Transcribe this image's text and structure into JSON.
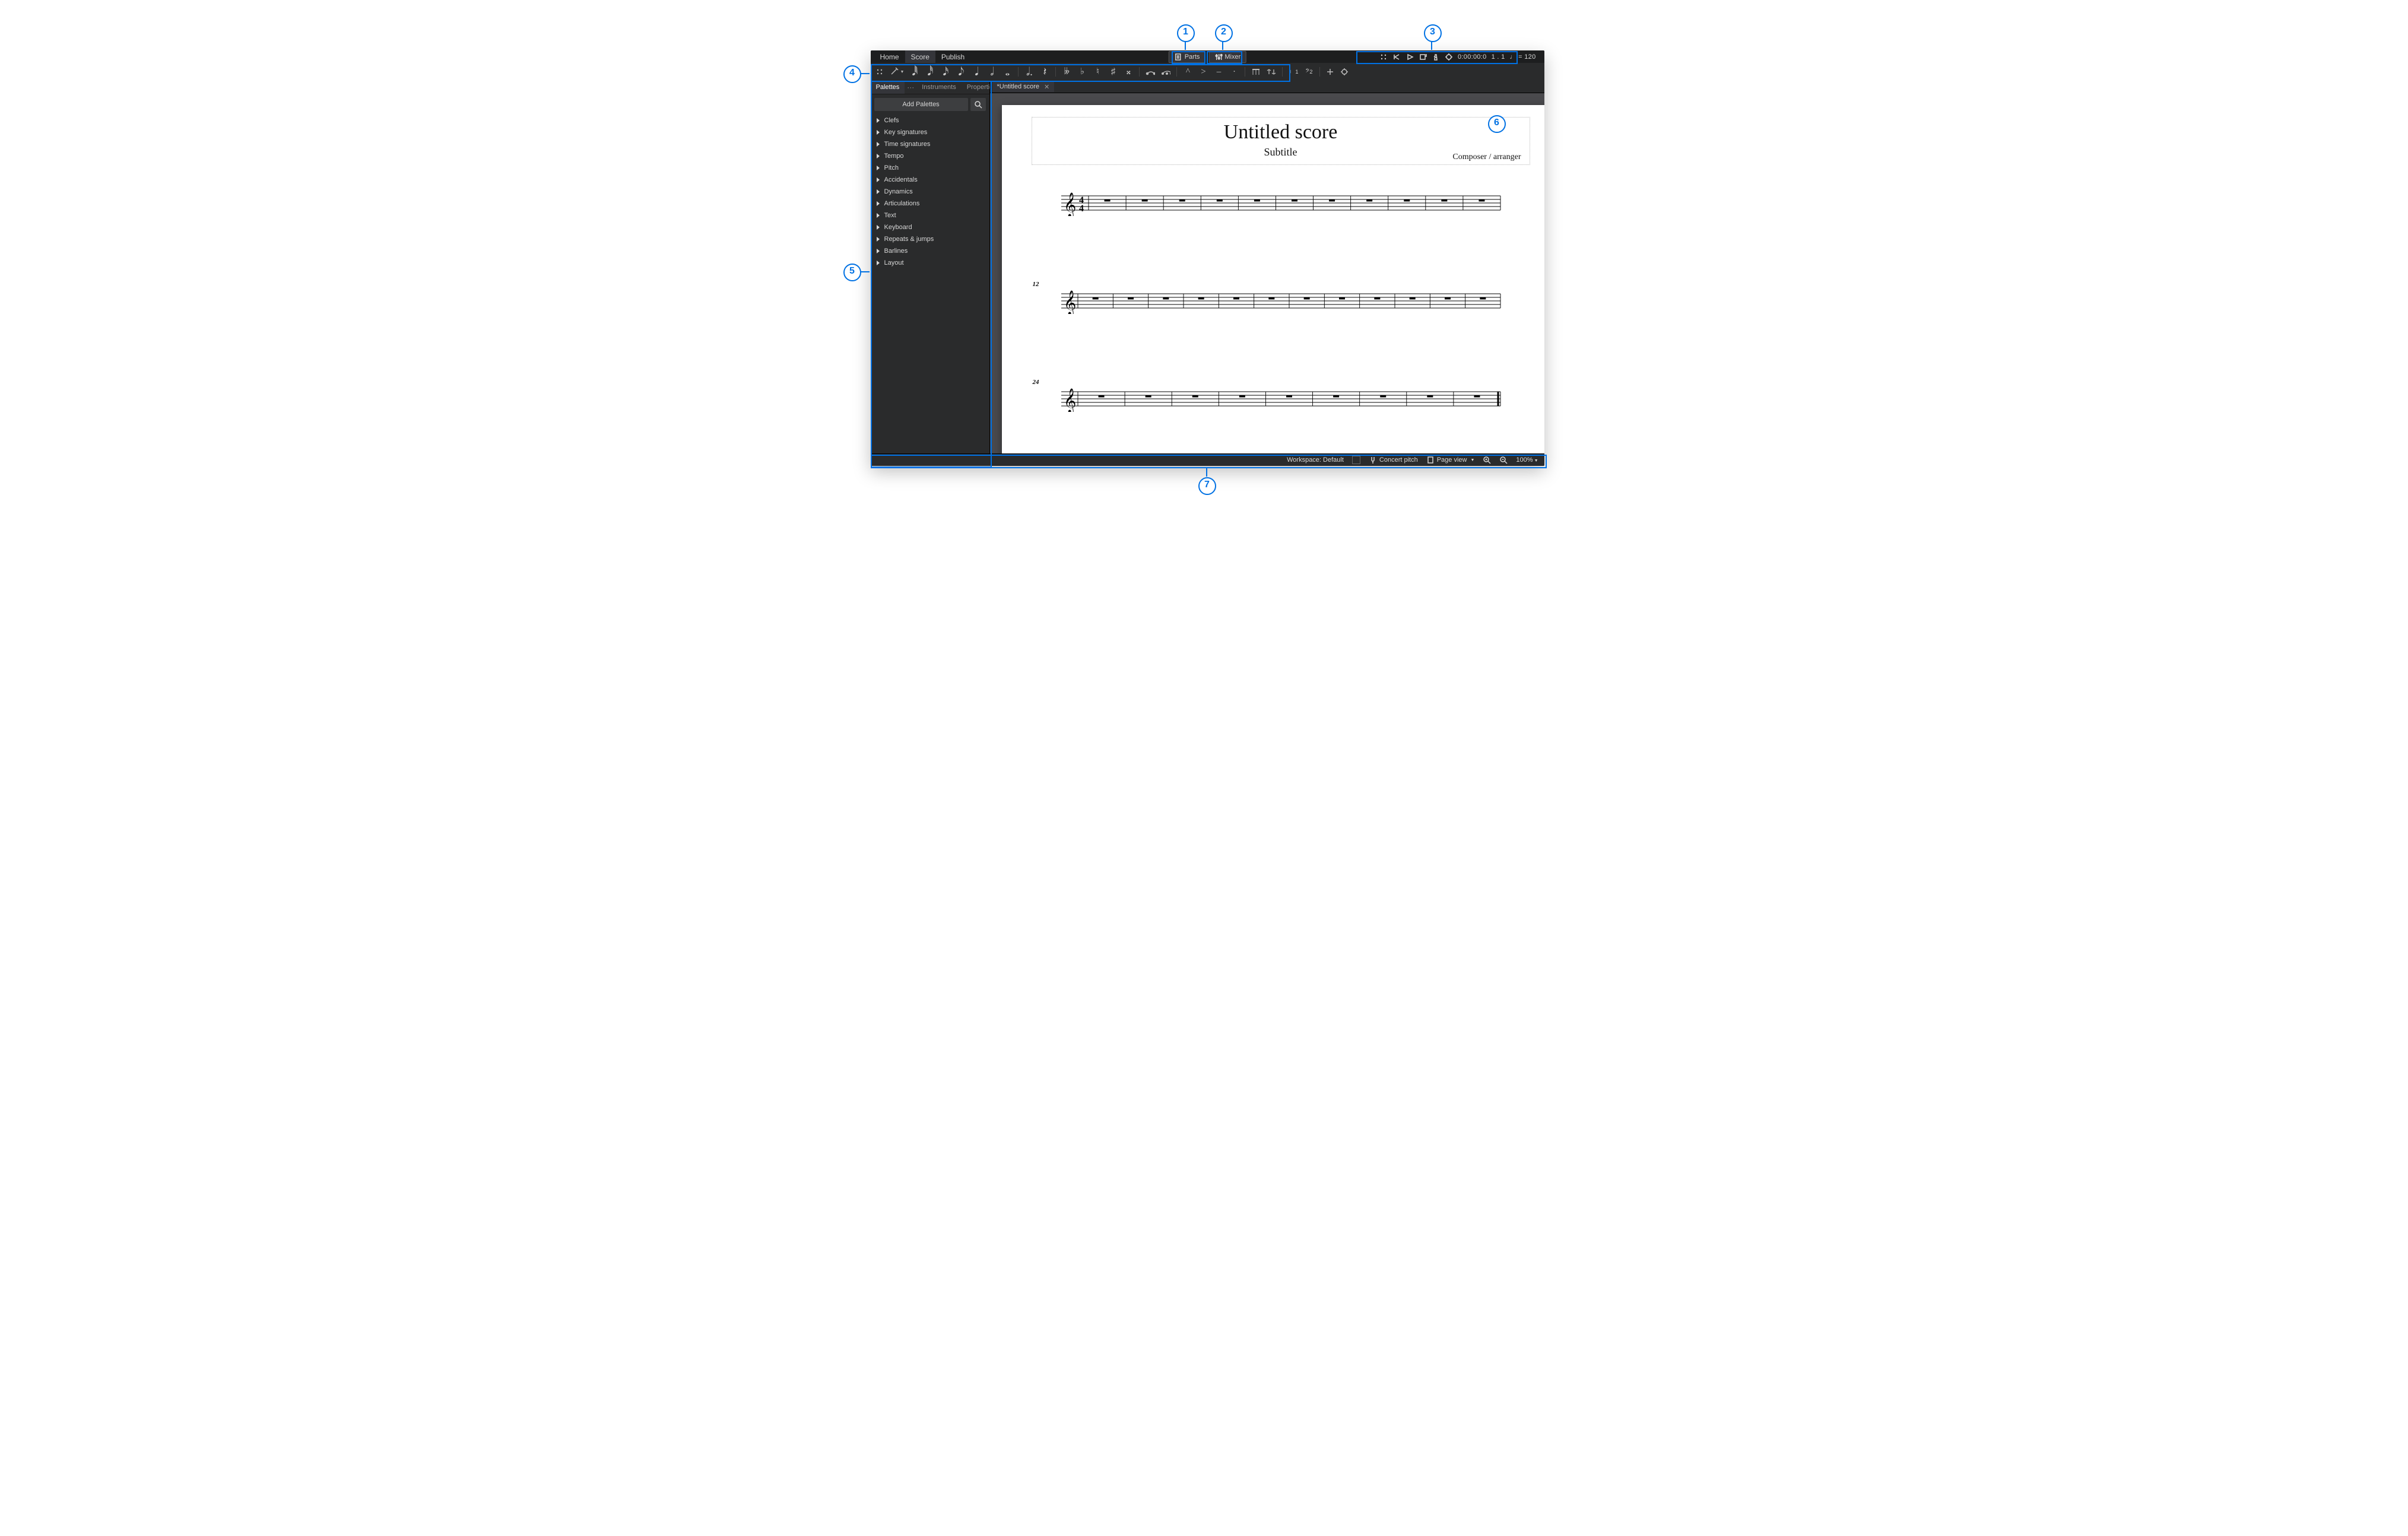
{
  "menubar": {
    "tabs": [
      "Home",
      "Score",
      "Publish"
    ],
    "activeIndex": 1,
    "parts_label": "Parts",
    "mixer_label": "Mixer",
    "time": "0:00:00:0",
    "beat": "1 . 1",
    "tempo_prefix": "♩ = ",
    "tempo_value": "120"
  },
  "sidebar": {
    "tabs": [
      "Palettes",
      "Instruments",
      "Properties"
    ],
    "activeIndex": 0,
    "add_label": "Add Palettes",
    "items": [
      {
        "label": "Clefs"
      },
      {
        "label": "Key signatures"
      },
      {
        "label": "Time signatures"
      },
      {
        "label": "Tempo"
      },
      {
        "label": "Pitch"
      },
      {
        "label": "Accidentals"
      },
      {
        "label": "Dynamics"
      },
      {
        "label": "Articulations"
      },
      {
        "label": "Text"
      },
      {
        "label": "Keyboard"
      },
      {
        "label": "Repeats & jumps"
      },
      {
        "label": "Barlines"
      },
      {
        "label": "Layout"
      }
    ]
  },
  "doc": {
    "tab_label": "*Untitled score",
    "title": "Untitled score",
    "subtitle": "Subtitle",
    "composer": "Composer / arranger",
    "system2_num": "12",
    "system3_num": "24"
  },
  "status": {
    "workspace": "Workspace: Default",
    "concert_pitch": "Concert pitch",
    "page_view": "Page view",
    "zoom": "100%"
  },
  "noteinput": {
    "durations": [
      "𝅘𝅥𝅱",
      "𝅘𝅥𝅰",
      "𝅘𝅥𝅯",
      "𝅘𝅥𝅮",
      "𝅘𝅥",
      "𝅗𝅥",
      "𝅝"
    ],
    "dotted": "𝅗𝅥.",
    "rest": "𝄽",
    "accidentals": [
      "𝄫",
      "♭",
      "♮",
      "♯",
      "𝄪"
    ],
    "ties": [
      "tie",
      "slur"
    ],
    "artics": [
      "^",
      ">",
      "–",
      "·"
    ],
    "beam_flip": [
      "flip-stem",
      "beam"
    ],
    "voice1": "1",
    "voice2": "2"
  },
  "callouts": {
    "1": "1",
    "2": "2",
    "3": "3",
    "4": "4",
    "5": "5",
    "6": "6",
    "7": "7"
  }
}
